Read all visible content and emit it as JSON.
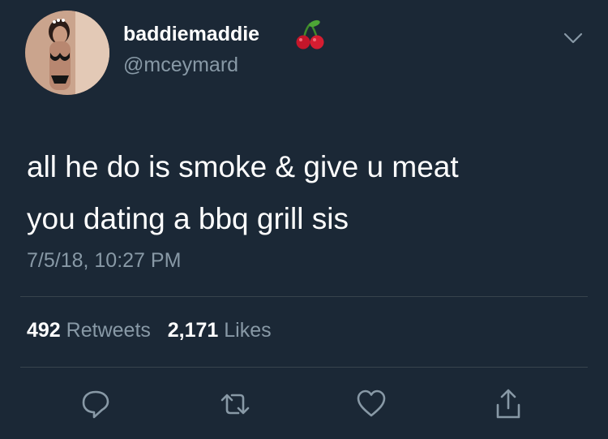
{
  "user": {
    "display_name": "baddiemaddie",
    "handle": "@mceymard",
    "name_emoji": "cherry-emoji"
  },
  "tweet": {
    "lines": [
      "all he do is smoke & give u meat",
      "you dating a bbq grill sis"
    ],
    "timestamp": "7/5/18, 10:27 PM"
  },
  "stats": {
    "retweets_count": "492",
    "retweets_label": "Retweets",
    "likes_count": "2,171",
    "likes_label": "Likes"
  },
  "actions": {
    "reply": "reply-icon",
    "retweet": "retweet-icon",
    "like": "heart-icon",
    "share": "share-icon"
  },
  "colors": {
    "background": "#1b2836",
    "primary_text": "#ffffff",
    "secondary_text": "#8899a6",
    "divider": "#38444d"
  }
}
